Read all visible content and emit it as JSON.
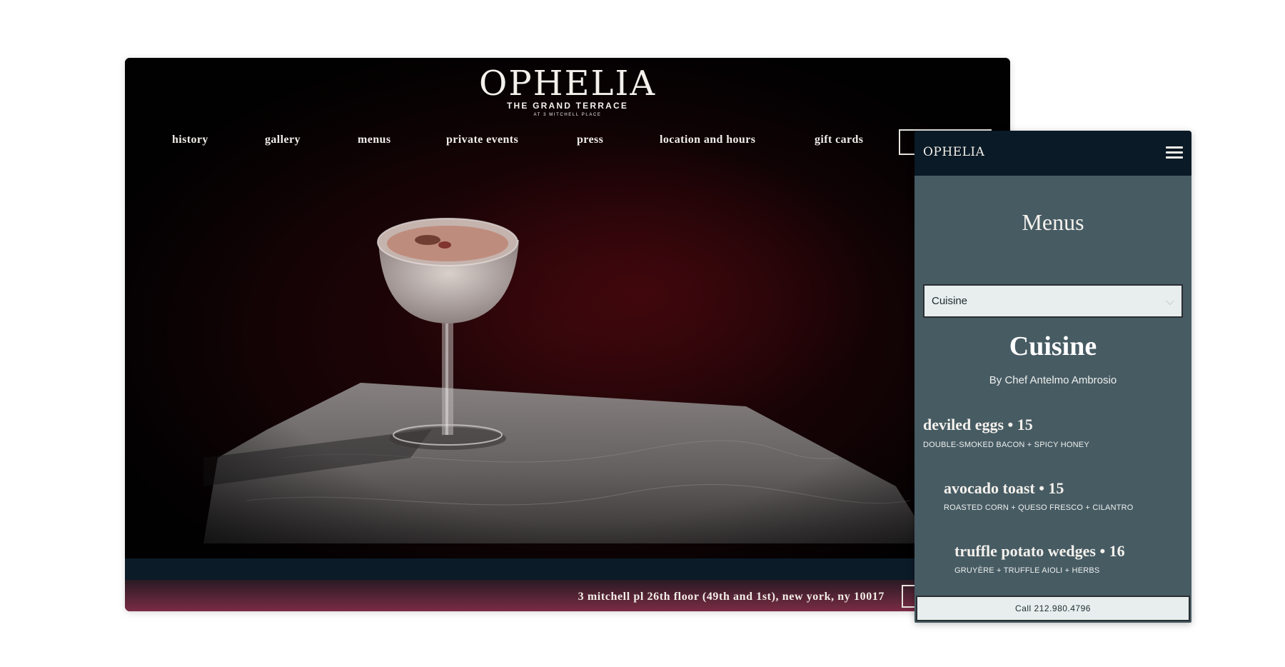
{
  "desktop": {
    "logo": "OPHELIA",
    "logo_subtitle": "THE GRAND TERRACE",
    "logo_tagline": "AT 3 MITCHELL PLACE",
    "nav": [
      "history",
      "gallery",
      "menus",
      "private events",
      "press",
      "location and hours",
      "gift cards"
    ],
    "footer_address": "3 mitchell pl 26th floor (49th and 1st), new york, ny 10017"
  },
  "mobile": {
    "logo": "OPHELIA",
    "page_title": "Menus",
    "select_value": "Cuisine",
    "section_title": "Cuisine",
    "chef": "By Chef Antelmo Ambrosio",
    "dishes": [
      {
        "name": "deviled eggs • 15",
        "desc": "DOUBLE-SMOKED BACON + SPICY HONEY"
      },
      {
        "name": "avocado toast • 15",
        "desc": "ROASTED CORN + QUESO FRESCO + CILANTRO"
      },
      {
        "name": "truffle potato wedges • 16",
        "desc": "GRUYÈRE + TRUFFLE AIOLI + HERBS"
      }
    ],
    "call_button": "Call 212.980.4796"
  },
  "colors": {
    "mobile_bg": "#475b63",
    "mobile_header": "#0a1a26",
    "footer_accent": "#7a2c44"
  },
  "icons": [
    "hamburger-menu-icon",
    "chevron-down-icon"
  ]
}
